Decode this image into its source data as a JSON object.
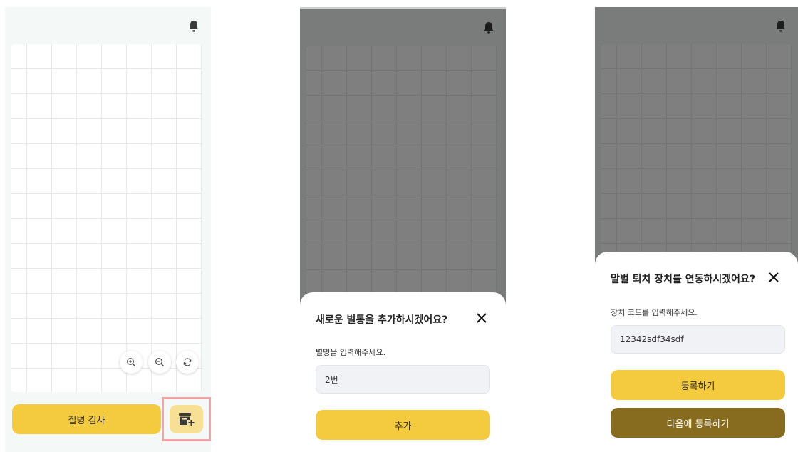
{
  "colors": {
    "primary_yellow": "#f4cb3f",
    "light_yellow": "#f7e094",
    "dark_gold": "#876b1e",
    "highlight_border": "#f1a3a5"
  },
  "screen1": {
    "icons": {
      "bell": "bell-icon",
      "zoom_in": "zoom-in-icon",
      "zoom_out": "zoom-out-icon",
      "refresh": "refresh-icon",
      "add_hive": "add-hive-icon"
    },
    "exam_button": "질병 검사"
  },
  "screen2": {
    "title": "새로운 벌통을 추가하시겠어요?",
    "label": "별명을 입력해주세요.",
    "input_value": "2번",
    "add_button": "추가"
  },
  "screen3": {
    "title": "말벌 퇴치 장치를 연동하시겠어요?",
    "label": "장치 코드를 입력해주세요.",
    "input_value": "12342sdf34sdf",
    "register_button": "등록하기",
    "later_button": "다음에 등록하기"
  }
}
